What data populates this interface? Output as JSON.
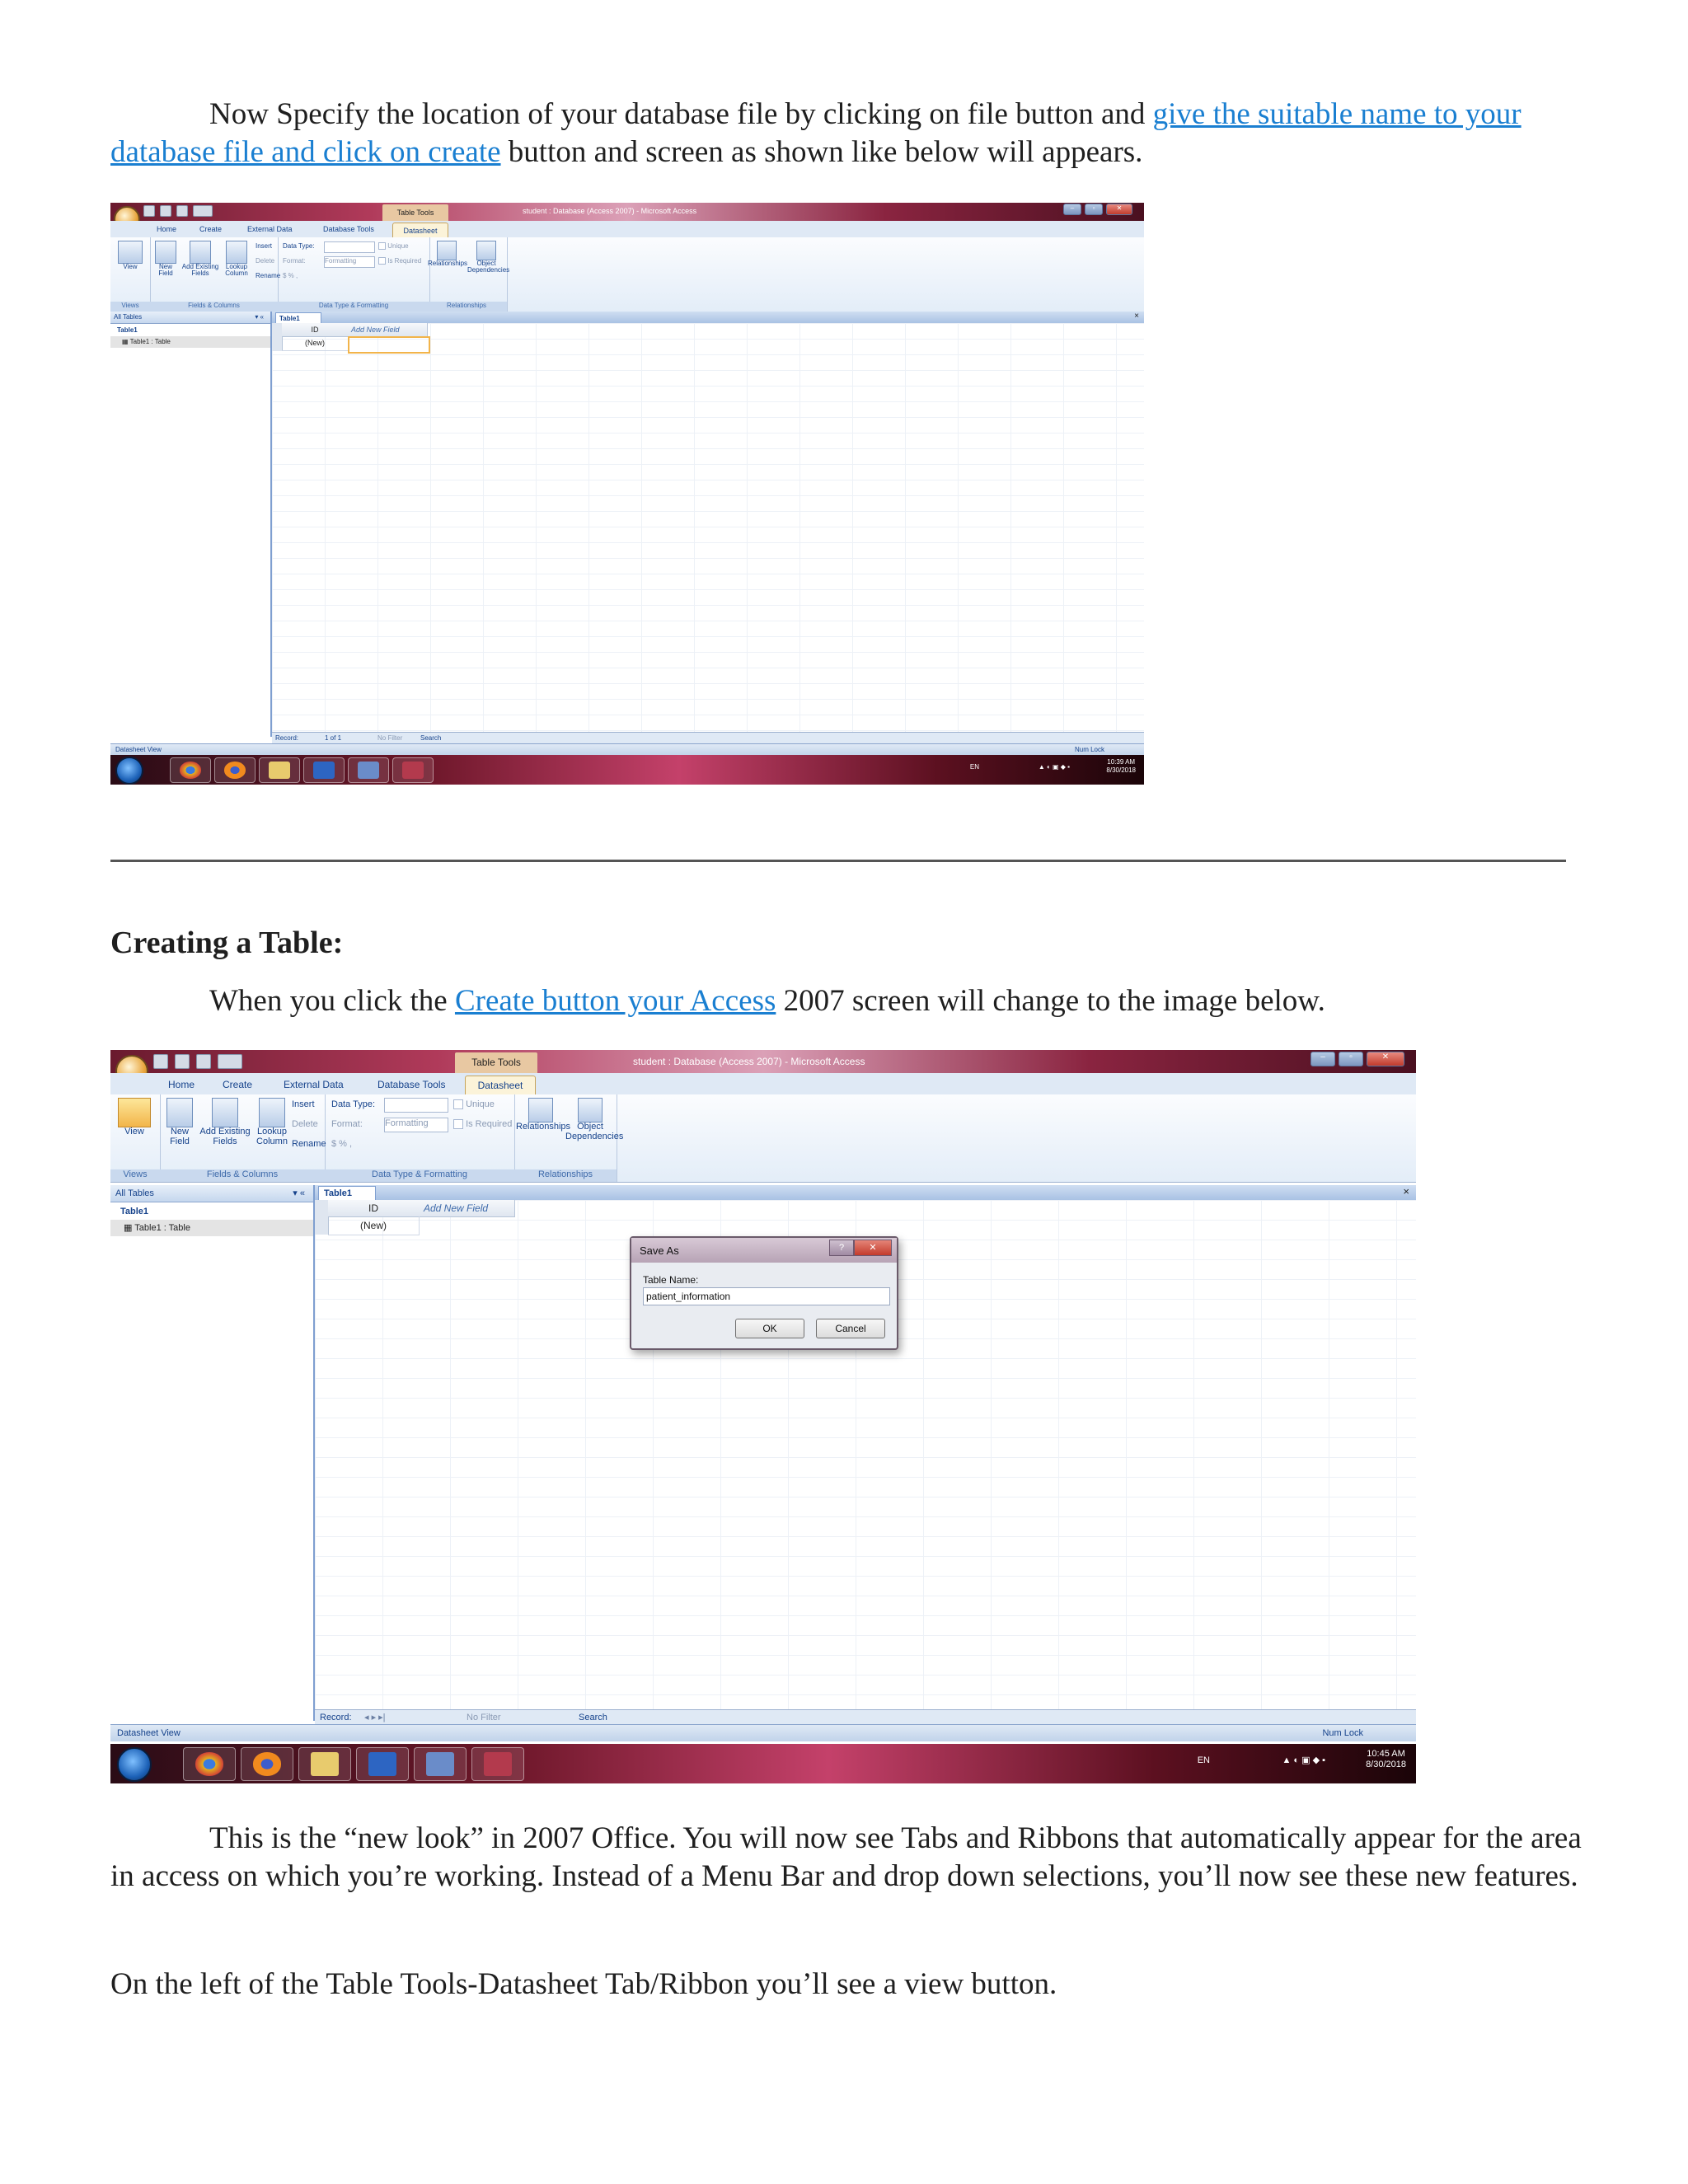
{
  "doc": {
    "p1_start": "Now Specify the location of your database file by clicking on file button and ",
    "p1_link": "give the suitable name to your database file and click on create",
    "p1_end": " button and screen as shown like below will appears.",
    "heading": "Creating a Table:",
    "p2_start": "When you click the ",
    "p2_link": "Create button your Access",
    "p2_end": " 2007 screen will change to the image below.",
    "p3": "This is the “new look” in 2007 Office. You will now see Tabs and Ribbons that automatically appear for the area in access on which you’re working. Instead of a Menu Bar and drop down selections, you’ll now see these new features.",
    "p4": "On the left of the Table Tools-Datasheet Tab/Ribbon you’ll see a view button."
  },
  "access": {
    "context_tab": "Table Tools",
    "window_title": "student : Database (Access 2007) - Microsoft Access",
    "tabs": [
      "Home",
      "Create",
      "External Data",
      "Database Tools",
      "Datasheet"
    ],
    "groups": {
      "views": "Views",
      "fields_columns": "Fields & Columns",
      "data_type_formatting": "Data Type & Formatting",
      "relationships": "Relationships"
    },
    "buttons": {
      "view": "View",
      "new_field_1": "New",
      "new_field_2": "Field",
      "add_existing_1": "Add Existing",
      "add_existing_2": "Fields",
      "lookup_1": "Lookup",
      "lookup_2": "Column",
      "insert": "Insert",
      "delete": "Delete",
      "rename": "Rename",
      "relationships": "Relationships",
      "object_dep_1": "Object",
      "object_dep_2": "Dependencies"
    },
    "format_labels": {
      "data_type": "Data Type:",
      "format": "Format:",
      "format_value": "Formatting",
      "unique": "Unique",
      "is_required": "Is Required",
      "currency": "$  %  ,"
    },
    "nav": {
      "header": "All Tables",
      "group": "Table1",
      "item": "Table1 : Table"
    },
    "doc_tab": "Table1",
    "columns": [
      "ID",
      "Add New Field"
    ],
    "new_row": "(New)",
    "record_nav": {
      "label": "Record:",
      "position_1": "1 of 1",
      "no_filter": "No Filter",
      "search": "Search"
    },
    "status": {
      "left": "Datasheet View",
      "right": "Num Lock"
    },
    "tray": {
      "lang": "EN",
      "time_1": "10:39 AM",
      "time_2": "10:45 AM",
      "date": "8/30/2018"
    },
    "dialog": {
      "title": "Save As",
      "label": "Table Name:",
      "value": "patient_information",
      "ok": "OK",
      "cancel": "Cancel"
    }
  }
}
